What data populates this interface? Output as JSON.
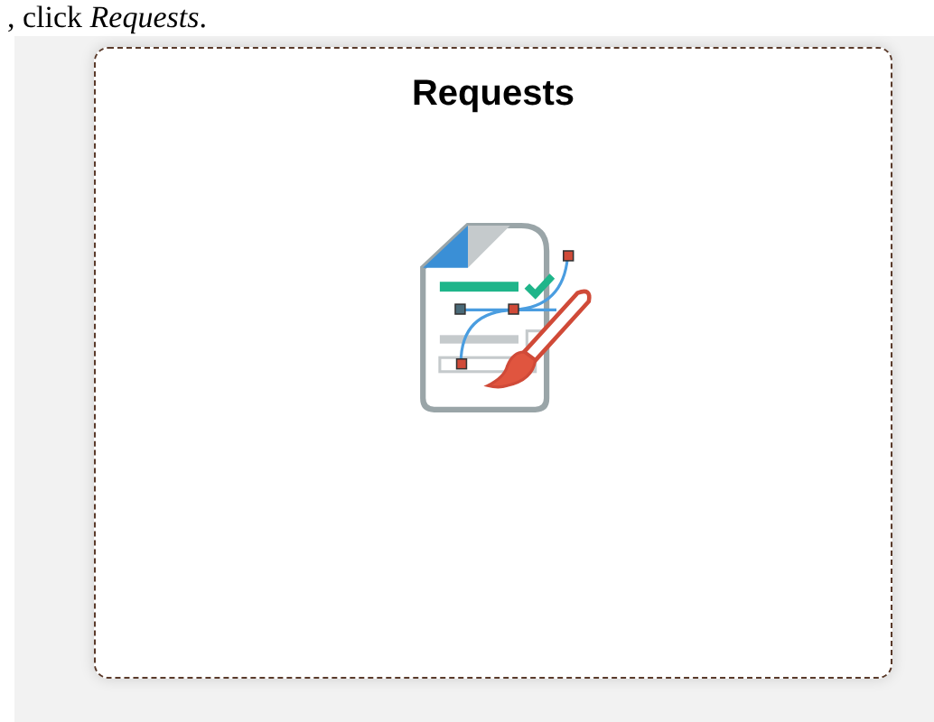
{
  "caption": ", click *Requests*.",
  "tile": {
    "title": "Requests"
  }
}
